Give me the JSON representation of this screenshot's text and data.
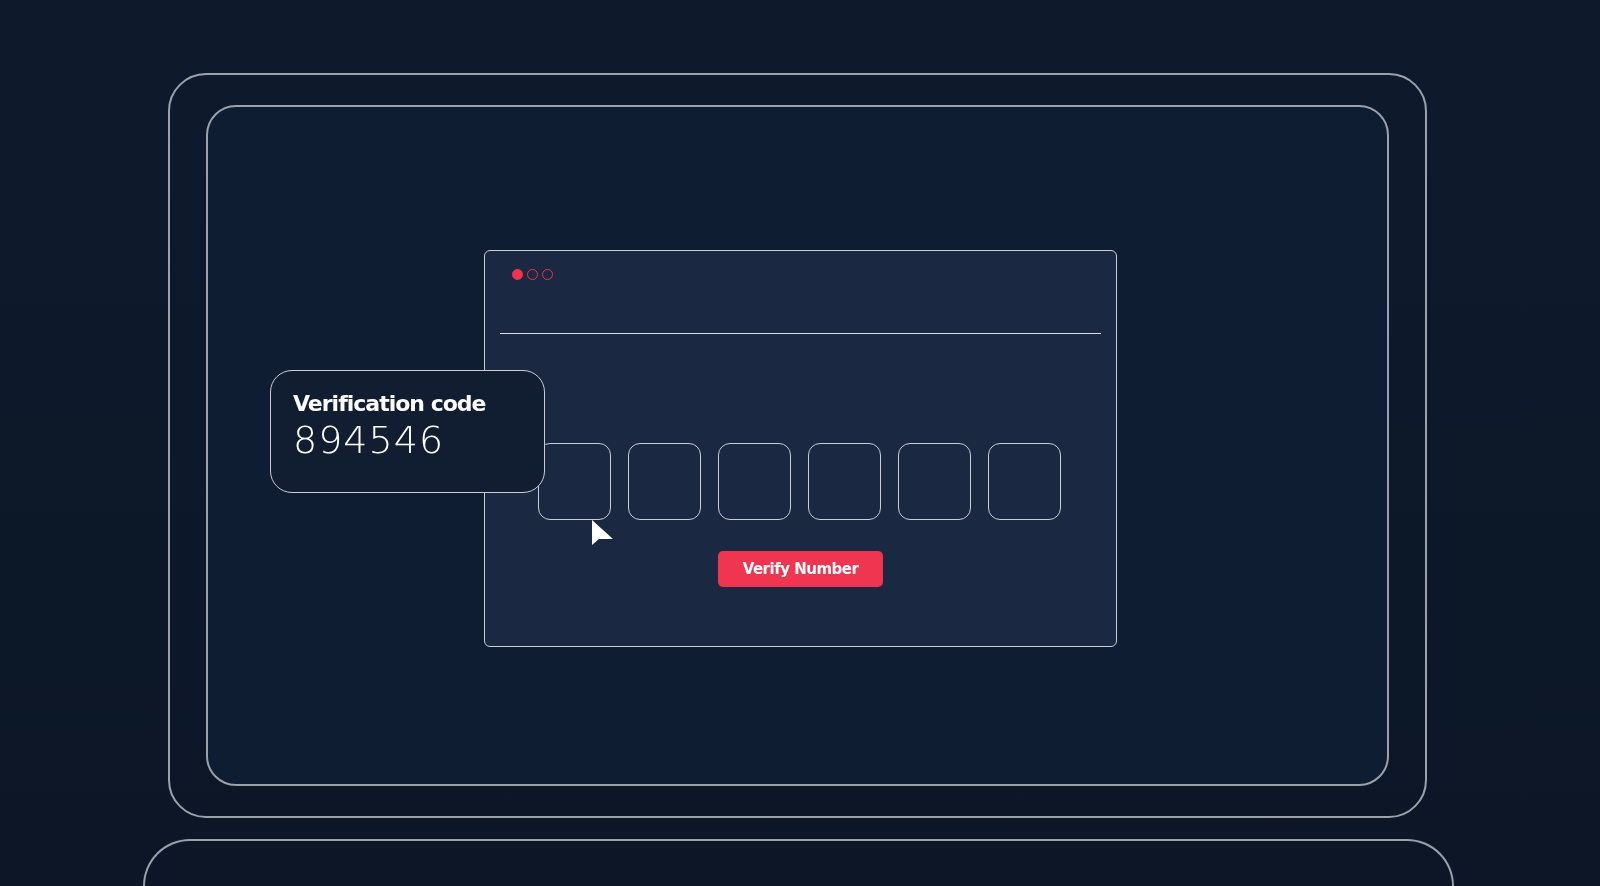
{
  "code_card": {
    "label": "Verification code",
    "code": "894546"
  },
  "verify_button": {
    "label": "Verify Number"
  }
}
